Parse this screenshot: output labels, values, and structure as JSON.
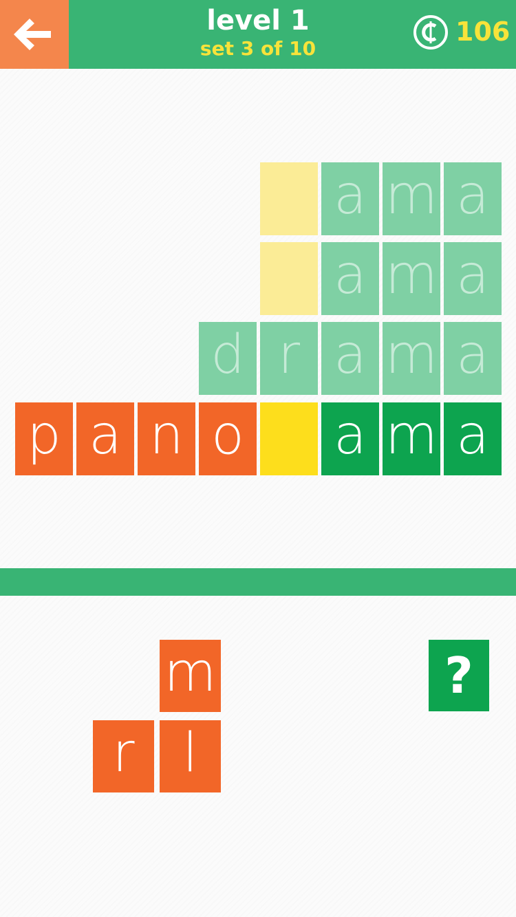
{
  "header": {
    "level_title": "level 1",
    "set_title": "set 3 of 10",
    "coins": "106",
    "back_icon": "back-arrow-icon",
    "coin_icon": "coin-icon"
  },
  "colors": {
    "header_green": "#39b474",
    "back_orange": "#f4864c",
    "accent_yellow": "#f7e33a",
    "tile_green": "#0da44f",
    "tile_orange": "#f26628",
    "tile_yellow": "#fdde1c"
  },
  "board": {
    "row1": [
      "",
      "a",
      "m",
      "a"
    ],
    "row2": [
      "",
      "a",
      "m",
      "a"
    ],
    "row3": [
      "d",
      "r",
      "a",
      "m",
      "a"
    ],
    "row4": [
      "p",
      "a",
      "n",
      "o",
      "",
      "a",
      "m",
      "a"
    ]
  },
  "letter_pool": [
    "m",
    "r",
    "l"
  ],
  "hint": {
    "label": "?"
  }
}
